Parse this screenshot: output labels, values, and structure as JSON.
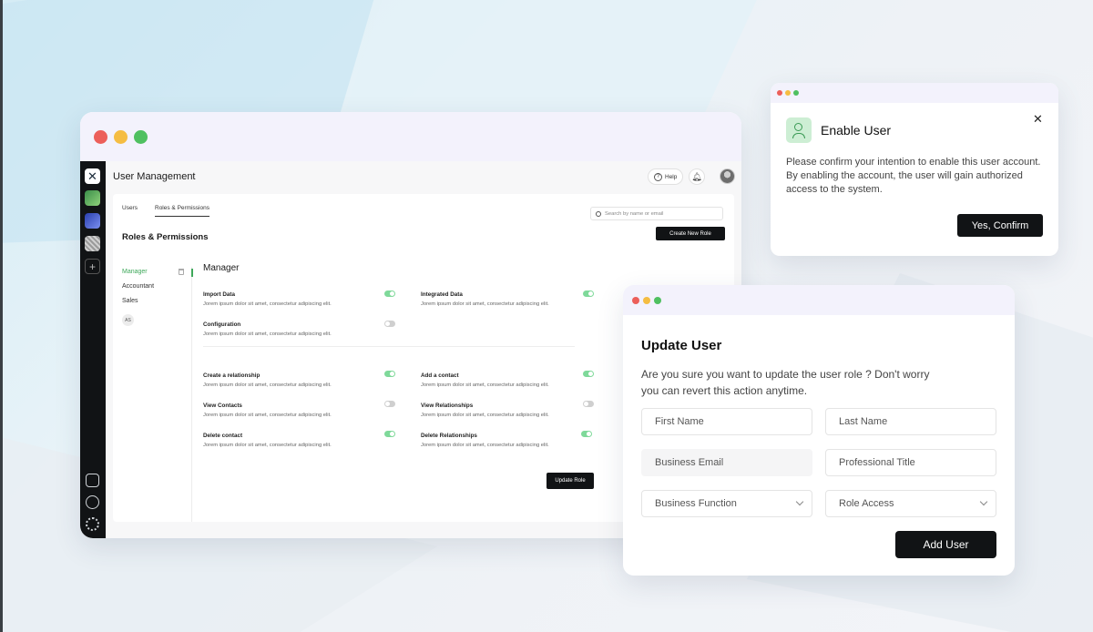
{
  "main_window": {
    "app_title": "User Management",
    "help_label": "Help",
    "tabs": [
      {
        "label": "Users"
      },
      {
        "label": "Roles & Permissions"
      }
    ],
    "search_placeholder": "Search by name or email",
    "section_title": "Roles & Permissions",
    "create_role_label": "Create New Role",
    "roles": [
      {
        "label": "Manager"
      },
      {
        "label": "Accountant"
      },
      {
        "label": "Sales"
      }
    ],
    "avatar_initials": "AS",
    "selected_role_title": "Manager",
    "permissions": [
      {
        "title": "Import Data",
        "desc": "Jorem ipsum dolor sit amet, consectetur adipiscing elit.",
        "enabled": true
      },
      {
        "title": "Integrated Data",
        "desc": "Jorem ipsum dolor sit amet, consectetur adipiscing elit.",
        "enabled": true
      },
      {
        "title": "Configuration",
        "desc": "Jorem ipsum dolor sit amet, consectetur adipiscing elit.",
        "enabled": false
      },
      {
        "title": "Create a relationship",
        "desc": "Jorem ipsum dolor sit amet, consectetur adipiscing elit.",
        "enabled": true
      },
      {
        "title": "Add a contact",
        "desc": "Jorem ipsum dolor sit amet, consectetur adipiscing elit.",
        "enabled": true
      },
      {
        "title": "View Contacts",
        "desc": "Jorem ipsum dolor sit amet, consectetur adipiscing elit.",
        "enabled": false
      },
      {
        "title": "View Relationships",
        "desc": "Jorem ipsum dolor sit amet, consectetur adipiscing elit.",
        "enabled": false
      },
      {
        "title": "Delete contact",
        "desc": "Jorem ipsum dolor sit amet, consectetur adipiscing elit.",
        "enabled": true
      },
      {
        "title": "Delete Relationships",
        "desc": "Jorem ipsum dolor sit amet, consectetur adipiscing elit.",
        "enabled": true
      }
    ],
    "update_role_label": "Update Role"
  },
  "enable_dialog": {
    "title": "Enable User",
    "body": "Please confirm your intention to enable this user account. By enabling the account, the user will gain authorized access to the system.",
    "confirm_label": "Yes, Confirm"
  },
  "update_dialog": {
    "title": "Update User",
    "body": "Are you sure you want to update the user role ? Don't worry you can revert this action anytime.",
    "fields": [
      {
        "placeholder": "First Name"
      },
      {
        "placeholder": "Last Name"
      },
      {
        "placeholder": "Business Email"
      },
      {
        "placeholder": "Professional Title"
      },
      {
        "placeholder": "Business Function"
      },
      {
        "placeholder": "Role Access"
      }
    ],
    "submit_label": "Add User"
  },
  "colors": {
    "accent_green": "#3ea85a",
    "toggle_on": "#7fd99a",
    "button_dark": "#111315"
  }
}
